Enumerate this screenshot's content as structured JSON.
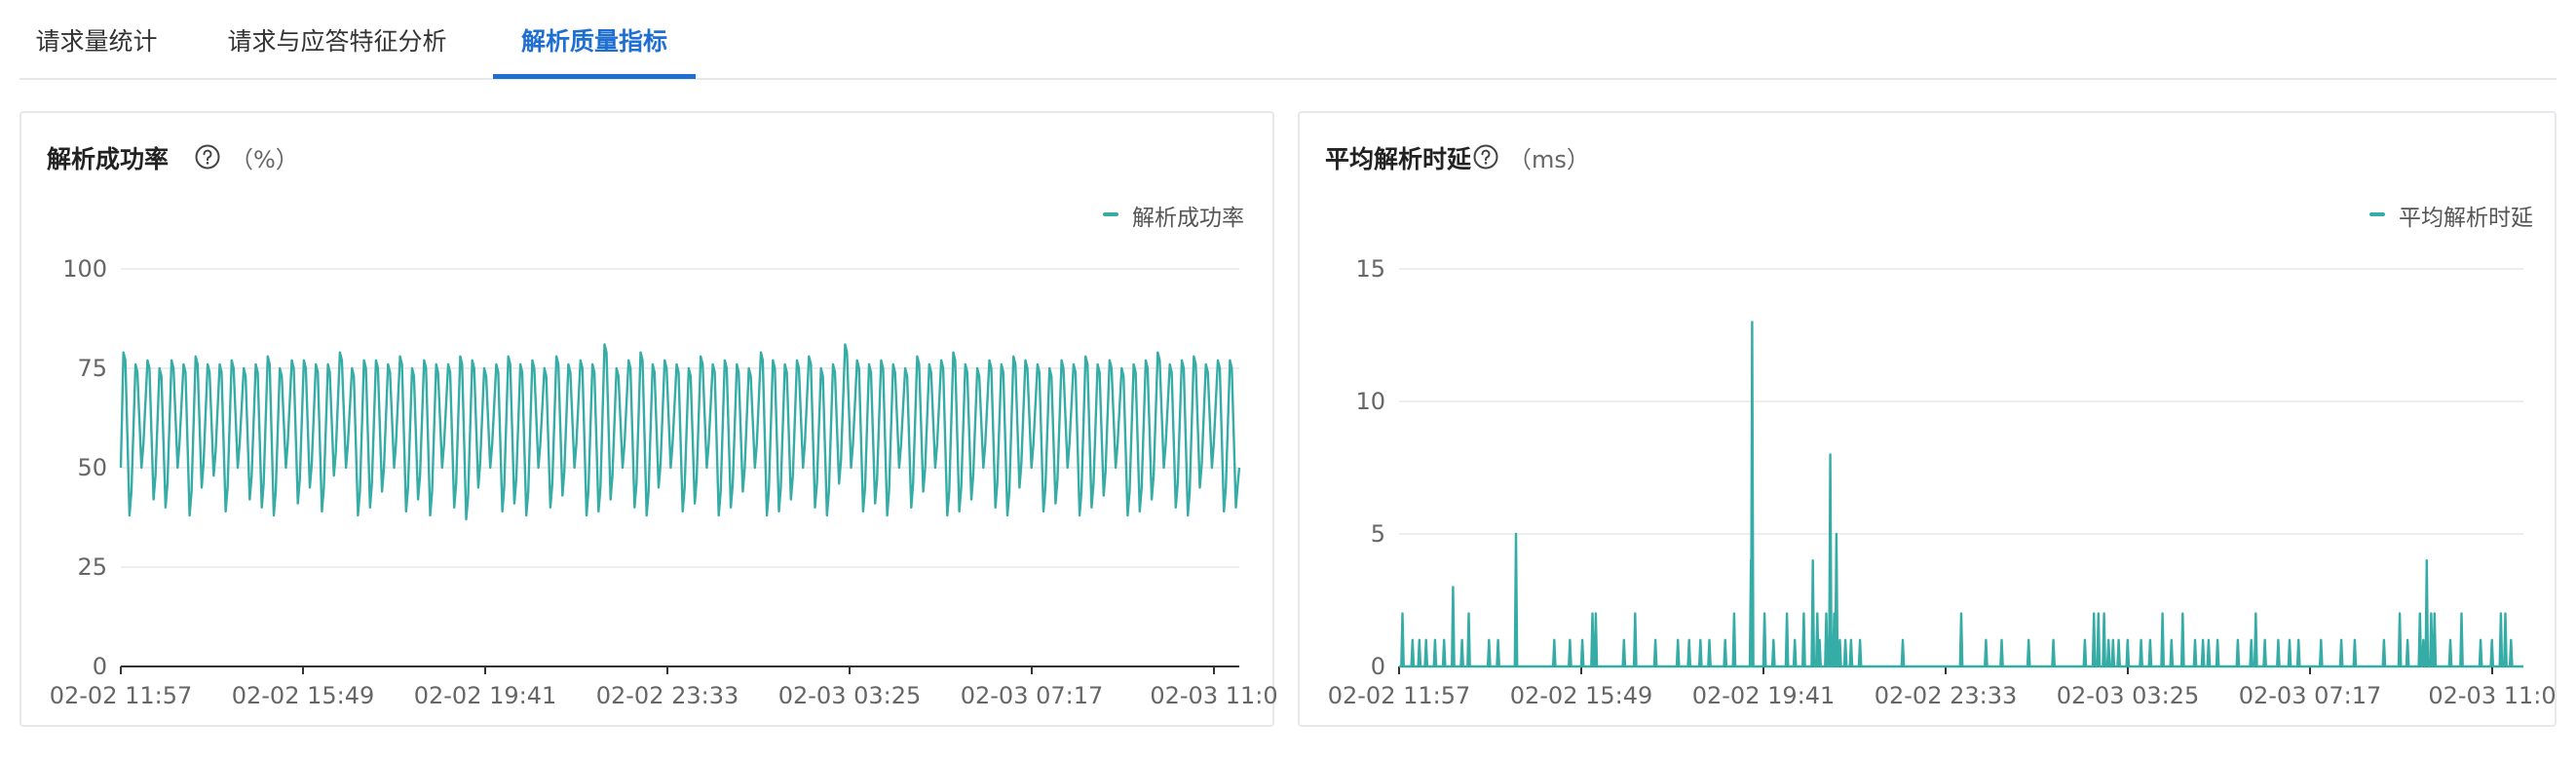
{
  "tabs": [
    {
      "label": "请求量统计",
      "active": false
    },
    {
      "label": "请求与应答特征分析",
      "active": false
    },
    {
      "label": "解析质量指标",
      "active": true
    }
  ],
  "cards": [
    {
      "title": "解析成功率",
      "unit": "（%）",
      "legend": "解析成功率"
    },
    {
      "title": "平均解析时延",
      "unit": "（ms）",
      "legend": "平均解析时延"
    }
  ],
  "colors": {
    "accent": "#1f6fd1",
    "series": "#36aca6",
    "grid": "#e8e8e8",
    "axis": "#333333"
  },
  "icons": {
    "help": "question-circle-icon"
  },
  "chart_data": [
    {
      "type": "line",
      "title": "解析成功率",
      "ylabel": "（%）",
      "ylim": [
        0,
        100
      ],
      "yticks": [
        0,
        25,
        50,
        75,
        100
      ],
      "x_tick_labels": [
        "02-02 11:57",
        "02-02 15:49",
        "02-02 19:41",
        "02-02 23:33",
        "02-03 03:25",
        "02-03 07:17",
        "02-03 11:0"
      ],
      "grid": true,
      "legend_position": "top-right",
      "series": [
        {
          "name": "解析成功率",
          "pattern": "oscillating",
          "cycles": 93,
          "peaks": [
            79,
            76,
            77,
            75,
            77,
            76,
            78,
            76,
            76,
            77,
            75,
            76,
            78,
            75,
            77,
            77,
            76,
            76,
            79,
            75,
            77,
            77,
            76,
            78,
            75,
            77,
            76,
            76,
            78,
            77,
            75,
            76,
            78,
            76,
            77,
            75,
            78,
            76,
            77,
            76,
            81,
            75,
            77,
            79,
            76,
            77,
            76,
            75,
            78,
            76,
            77,
            76,
            75,
            79,
            77,
            76,
            77,
            78,
            75,
            76,
            81,
            77,
            76,
            77,
            76,
            75,
            78,
            76,
            77,
            79,
            76,
            75,
            77,
            76,
            78,
            77,
            76,
            75,
            77,
            76,
            78,
            76,
            77,
            75,
            76,
            77,
            79,
            76,
            77,
            78,
            76,
            77,
            77
          ],
          "troughs": [
            38,
            50,
            42,
            40,
            50,
            38,
            45,
            48,
            39,
            50,
            42,
            40,
            38,
            50,
            41,
            45,
            39,
            48,
            50,
            38,
            40,
            44,
            50,
            39,
            42,
            38,
            50,
            40,
            37,
            45,
            50,
            39,
            41,
            38,
            50,
            40,
            43,
            50,
            38,
            39,
            42,
            50,
            40,
            38,
            45,
            50,
            39,
            41,
            50,
            38,
            40,
            44,
            50,
            38,
            39,
            42,
            50,
            40,
            38,
            46,
            50,
            39,
            41,
            38,
            50,
            40,
            44,
            50,
            38,
            39,
            42,
            50,
            40,
            38,
            45,
            50,
            39,
            41,
            50,
            38,
            40,
            43,
            50,
            38,
            39,
            42,
            50,
            40,
            38,
            45,
            50,
            39,
            40
          ]
        }
      ]
    },
    {
      "type": "line",
      "title": "平均解析时延",
      "ylabel": "（ms）",
      "ylim": [
        0,
        15
      ],
      "yticks": [
        0,
        5,
        10,
        15
      ],
      "x_tick_labels": [
        "02-02 11:57",
        "02-02 15:49",
        "02-02 19:41",
        "02-02 23:33",
        "02-03 03:25",
        "02-03 07:17",
        "02-03 11:0"
      ],
      "grid": true,
      "legend_position": "top-right",
      "series": [
        {
          "name": "平均解析时延",
          "pattern": "sparse-spikes",
          "spikes": [
            [
              0.003,
              2
            ],
            [
              0.012,
              1
            ],
            [
              0.018,
              1
            ],
            [
              0.024,
              1
            ],
            [
              0.032,
              1
            ],
            [
              0.04,
              1
            ],
            [
              0.048,
              3
            ],
            [
              0.056,
              1
            ],
            [
              0.062,
              2
            ],
            [
              0.08,
              1
            ],
            [
              0.088,
              1
            ],
            [
              0.104,
              5
            ],
            [
              0.138,
              1
            ],
            [
              0.152,
              1
            ],
            [
              0.163,
              1
            ],
            [
              0.172,
              2
            ],
            [
              0.175,
              2
            ],
            [
              0.2,
              1
            ],
            [
              0.21,
              2
            ],
            [
              0.228,
              1
            ],
            [
              0.248,
              1
            ],
            [
              0.258,
              1
            ],
            [
              0.268,
              1
            ],
            [
              0.276,
              1
            ],
            [
              0.29,
              1
            ],
            [
              0.298,
              2
            ],
            [
              0.313,
              4
            ],
            [
              0.314,
              13
            ],
            [
              0.325,
              2
            ],
            [
              0.333,
              1
            ],
            [
              0.345,
              2
            ],
            [
              0.352,
              1
            ],
            [
              0.36,
              2
            ],
            [
              0.368,
              4
            ],
            [
              0.372,
              2
            ],
            [
              0.374,
              1
            ],
            [
              0.38,
              2
            ],
            [
              0.382,
              1
            ],
            [
              0.3835,
              8
            ],
            [
              0.387,
              2
            ],
            [
              0.389,
              5
            ],
            [
              0.392,
              1
            ],
            [
              0.397,
              1
            ],
            [
              0.402,
              1
            ],
            [
              0.41,
              1
            ],
            [
              0.448,
              1
            ],
            [
              0.5,
              2
            ],
            [
              0.522,
              1
            ],
            [
              0.536,
              1
            ],
            [
              0.56,
              1
            ],
            [
              0.582,
              1
            ],
            [
              0.61,
              1
            ],
            [
              0.618,
              2
            ],
            [
              0.622,
              2
            ],
            [
              0.627,
              2
            ],
            [
              0.631,
              1
            ],
            [
              0.635,
              1
            ],
            [
              0.64,
              1
            ],
            [
              0.648,
              1
            ],
            [
              0.66,
              1
            ],
            [
              0.668,
              1
            ],
            [
              0.679,
              2
            ],
            [
              0.687,
              1
            ],
            [
              0.697,
              2
            ],
            [
              0.708,
              1
            ],
            [
              0.715,
              1
            ],
            [
              0.72,
              1
            ],
            [
              0.728,
              1
            ],
            [
              0.746,
              1
            ],
            [
              0.758,
              1
            ],
            [
              0.762,
              2
            ],
            [
              0.77,
              1
            ],
            [
              0.782,
              1
            ],
            [
              0.792,
              1
            ],
            [
              0.8,
              1
            ],
            [
              0.82,
              1
            ],
            [
              0.838,
              1
            ],
            [
              0.85,
              1
            ],
            [
              0.876,
              1
            ],
            [
              0.89,
              2
            ],
            [
              0.897,
              1
            ],
            [
              0.908,
              2
            ],
            [
              0.911,
              1
            ],
            [
              0.914,
              4
            ],
            [
              0.918,
              2
            ],
            [
              0.921,
              2
            ],
            [
              0.935,
              1
            ],
            [
              0.945,
              2
            ],
            [
              0.962,
              1
            ],
            [
              0.972,
              1
            ],
            [
              0.98,
              2
            ],
            [
              0.984,
              2
            ],
            [
              0.989,
              1
            ]
          ]
        }
      ]
    }
  ]
}
